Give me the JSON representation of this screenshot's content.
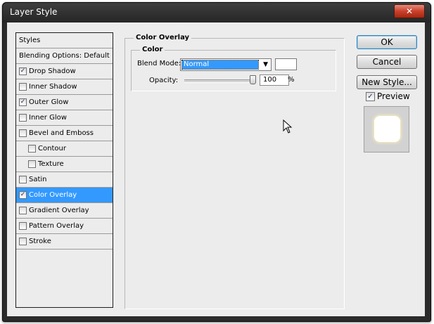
{
  "window": {
    "title": "Layer Style",
    "close_glyph": "✕"
  },
  "styles_panel": {
    "header": "Styles",
    "blending_options": "Blending Options: Default",
    "items": [
      {
        "label": "Drop Shadow",
        "checked": true
      },
      {
        "label": "Inner Shadow",
        "checked": false
      },
      {
        "label": "Outer Glow",
        "checked": true
      },
      {
        "label": "Inner Glow",
        "checked": false
      },
      {
        "label": "Bevel and Emboss",
        "checked": false
      },
      {
        "label": "Contour",
        "checked": false,
        "indent": true
      },
      {
        "label": "Texture",
        "checked": false,
        "indent": true
      },
      {
        "label": "Satin",
        "checked": false
      },
      {
        "label": "Color Overlay",
        "checked": true,
        "selected": true
      },
      {
        "label": "Gradient Overlay",
        "checked": false
      },
      {
        "label": "Pattern Overlay",
        "checked": false
      },
      {
        "label": "Stroke",
        "checked": false
      }
    ]
  },
  "color_overlay": {
    "group_title": "Color Overlay",
    "subgroup_title": "Color",
    "blend_mode_label": "Blend Mode:",
    "blend_mode_value": "Normal",
    "overlay_color": "#ffffff",
    "opacity_label": "Opacity:",
    "opacity_value": "100",
    "opacity_unit": "%"
  },
  "buttons": {
    "ok": "OK",
    "cancel": "Cancel",
    "new_style": "New Style..."
  },
  "preview": {
    "label": "Preview",
    "checked": true
  },
  "colors": {
    "selection": "#3399ff",
    "dialog_bg": "#ececec",
    "close_red": "#c9412c"
  }
}
